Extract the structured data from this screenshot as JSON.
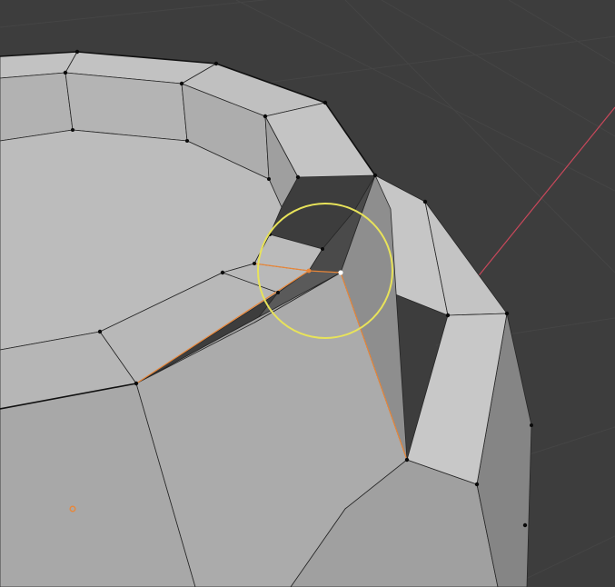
{
  "viewport": {
    "background_color": "#3d3d3d",
    "grid_color": "#444444",
    "x_axis_color": "#c9485b"
  },
  "mesh": {
    "face_color_light": "#b8b8b8",
    "face_color_mid": "#a9a9a9",
    "face_color_dark": "#7a7a7a",
    "edge_color": "#262626",
    "vertex_color": "#0a0a0a",
    "selected_edge_color": "#e8873a",
    "active_vertex_color": "#ffffff"
  },
  "tool": {
    "name": "proportional-edit-circle",
    "circle_color": "#e8e35a"
  },
  "origin": {
    "color": "#e8873a"
  },
  "icons": [
    "origin-icon",
    "brush-circle-icon"
  ]
}
